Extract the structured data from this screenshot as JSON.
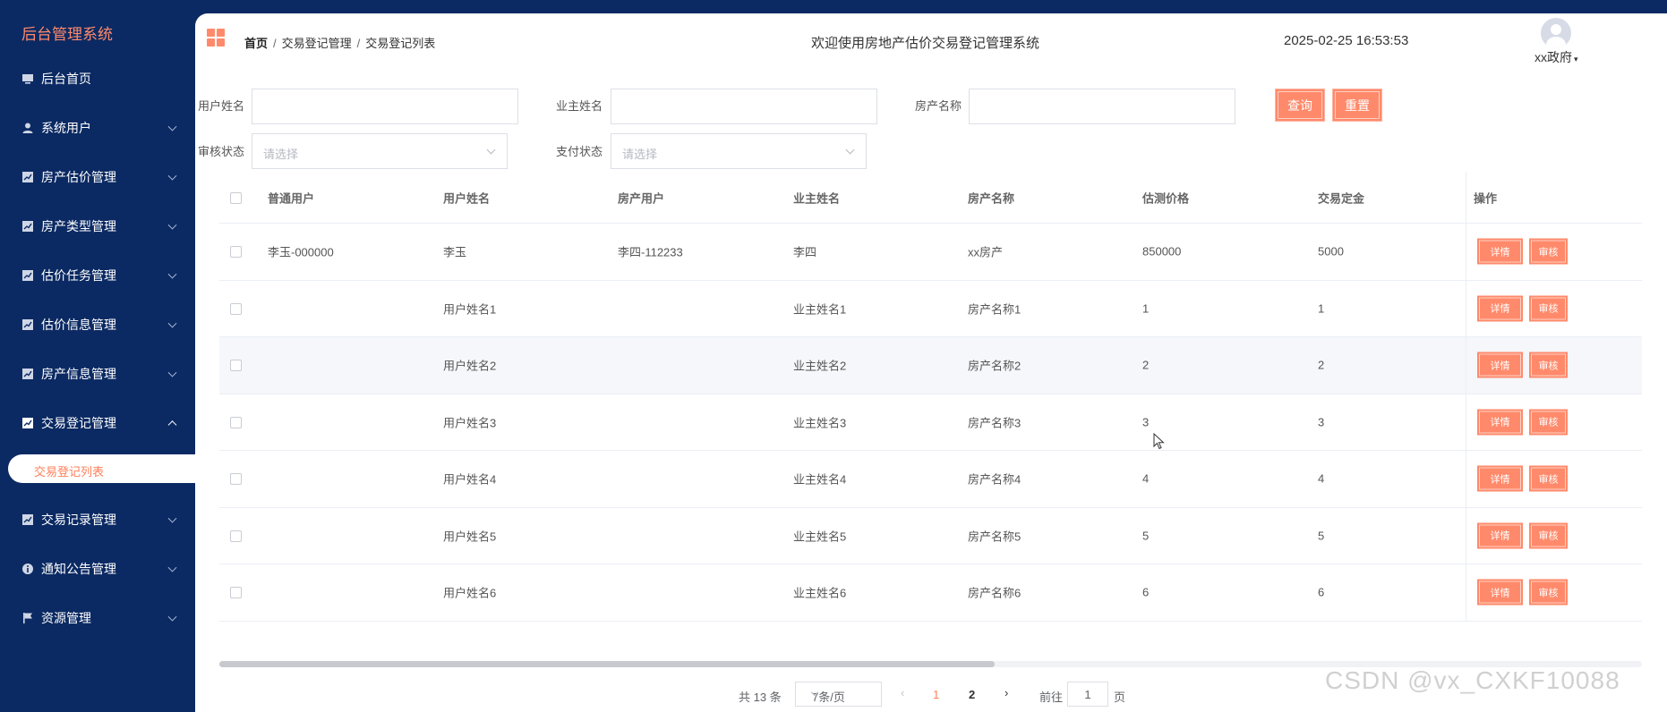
{
  "app": {
    "title": "后台管理系统"
  },
  "sidebar": {
    "items": [
      {
        "label": "后台首页",
        "icon": "monitor-icon",
        "expandable": false
      },
      {
        "label": "系统用户",
        "icon": "user-icon",
        "expandable": true
      },
      {
        "label": "房产估价管理",
        "icon": "chart-icon",
        "expandable": true
      },
      {
        "label": "房产类型管理",
        "icon": "chart-icon",
        "expandable": true
      },
      {
        "label": "估价任务管理",
        "icon": "chart-icon",
        "expandable": true
      },
      {
        "label": "估价信息管理",
        "icon": "chart-icon",
        "expandable": true
      },
      {
        "label": "房产信息管理",
        "icon": "chart-icon",
        "expandable": true
      },
      {
        "label": "交易登记管理",
        "icon": "chart-icon",
        "expandable": true,
        "expanded": true
      }
    ],
    "submenu": {
      "label": "交易登记列表",
      "active": true
    },
    "lower_items": [
      {
        "label": "交易记录管理",
        "icon": "chart-icon"
      },
      {
        "label": "通知公告管理",
        "icon": "info-icon"
      },
      {
        "label": "资源管理",
        "icon": "flag-icon"
      }
    ]
  },
  "header": {
    "breadcrumb": [
      "首页",
      "交易登记管理",
      "交易登记列表"
    ],
    "welcome": "欢迎使用房地产估价交易登记管理系统",
    "datetime": "2025-02-25 16:53:53",
    "username": "xx政府"
  },
  "search": {
    "user_name_label": "用户姓名",
    "owner_name_label": "业主姓名",
    "property_name_label": "房产名称",
    "audit_status_label": "审核状态",
    "pay_status_label": "支付状态",
    "select_placeholder": "请选择",
    "query_button": "查询",
    "reset_button": "重置"
  },
  "table": {
    "columns": [
      "普通用户",
      "用户姓名",
      "房产用户",
      "业主姓名",
      "房产名称",
      "估测价格",
      "交易定金",
      "操作"
    ],
    "rows": [
      [
        "李玉-000000",
        "李玉",
        "李四-112233",
        "李四",
        "xx房产",
        "850000",
        "5000"
      ],
      [
        "",
        "用户姓名1",
        "",
        "业主姓名1",
        "房产名称1",
        "1",
        "1"
      ],
      [
        "",
        "用户姓名2",
        "",
        "业主姓名2",
        "房产名称2",
        "2",
        "2"
      ],
      [
        "",
        "用户姓名3",
        "",
        "业主姓名3",
        "房产名称3",
        "3",
        "3"
      ],
      [
        "",
        "用户姓名4",
        "",
        "业主姓名4",
        "房产名称4",
        "4",
        "4"
      ],
      [
        "",
        "用户姓名5",
        "",
        "业主姓名5",
        "房产名称5",
        "5",
        "5"
      ],
      [
        "",
        "用户姓名6",
        "",
        "业主姓名6",
        "房产名称6",
        "6",
        "6"
      ]
    ],
    "row_actions": {
      "detail": "详情",
      "audit": "审核"
    }
  },
  "pagination": {
    "total": "共 13 条",
    "page_size": "7条/页",
    "pages": [
      "1",
      "2"
    ],
    "current_page": "1",
    "goto_label": "前往",
    "goto_value": "1",
    "page_suffix": "页"
  },
  "watermark": "CSDN @vx_CXKF10088",
  "colors": {
    "sidebar_bg": "#0b2a63",
    "accent": "#ff8a6b",
    "active_text": "#ff7f5a"
  }
}
